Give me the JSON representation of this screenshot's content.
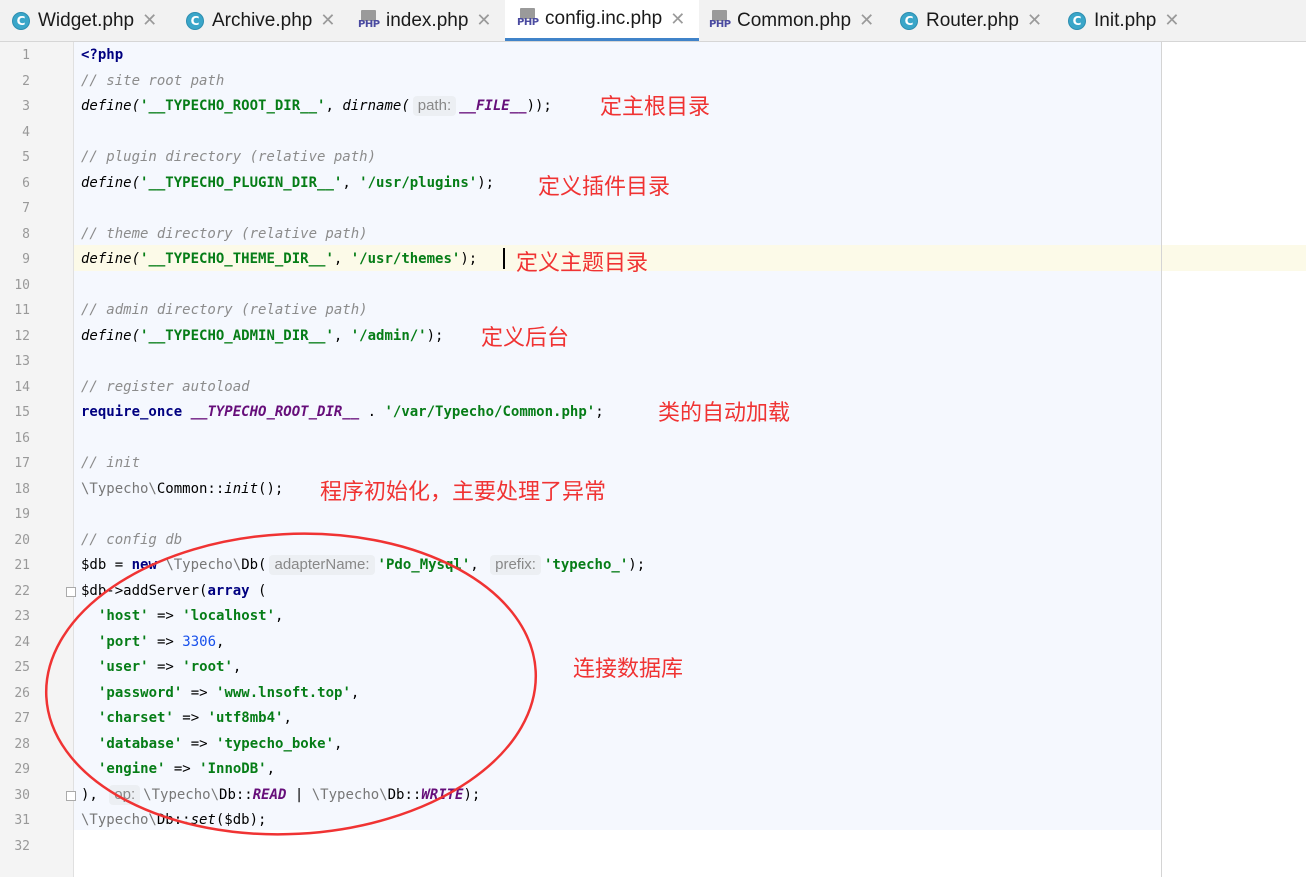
{
  "tabs": [
    {
      "name": "Widget.php",
      "icon": "class-c-icon",
      "active": false
    },
    {
      "name": "Archive.php",
      "icon": "class-c-icon",
      "active": false
    },
    {
      "name": "index.php",
      "icon": "php-file-icon",
      "active": false
    },
    {
      "name": "config.inc.php",
      "icon": "php-file-icon",
      "active": true
    },
    {
      "name": "Common.php",
      "icon": "php-file-icon",
      "active": false
    },
    {
      "name": "Router.php",
      "icon": "class-c-icon",
      "active": false
    },
    {
      "name": "Init.php",
      "icon": "class-c-icon",
      "active": false
    }
  ],
  "close_glyph": "✕",
  "line_numbers": [
    "1",
    "2",
    "3",
    "4",
    "5",
    "6",
    "7",
    "8",
    "9",
    "10",
    "11",
    "12",
    "13",
    "14",
    "15",
    "16",
    "17",
    "18",
    "19",
    "20",
    "21",
    "22",
    "23",
    "24",
    "25",
    "26",
    "27",
    "28",
    "29",
    "30",
    "31",
    "32"
  ],
  "code": {
    "l1": "<?php",
    "l2": "// site root path",
    "l3": {
      "a": "define(",
      "b": "'__TYPECHO_ROOT_DIR__'",
      "c": ", ",
      "d": "dirname(",
      "hint": "path:",
      "e": "__FILE__",
      "f": "));"
    },
    "l5": "// plugin directory (relative path)",
    "l6": {
      "a": "define(",
      "b": "'__TYPECHO_PLUGIN_DIR__'",
      "c": ", ",
      "d": "'/usr/plugins'",
      "e": ");"
    },
    "l8": "// theme directory (relative path)",
    "l9": {
      "a": "define(",
      "b": "'__TYPECHO_THEME_DIR__'",
      "c": ", ",
      "d": "'/usr/themes'",
      "e": ");"
    },
    "l11": "// admin directory (relative path)",
    "l12": {
      "a": "define(",
      "b": "'__TYPECHO_ADMIN_DIR__'",
      "c": ", ",
      "d": "'/admin/'",
      "e": ");"
    },
    "l14": "// register autoload",
    "l15": {
      "a": "require_once",
      "b": " ",
      "c": "__TYPECHO_ROOT_DIR__",
      "d": " . ",
      "e": "'/var/Typecho/Common.php'",
      "f": ";"
    },
    "l17": "// init",
    "l18": {
      "a": "\\Typecho\\",
      "b": "Common::",
      "c": "init",
      "d": "();"
    },
    "l20": "// config db",
    "l21": {
      "a": "$db",
      "b": " = ",
      "c": "new",
      "d": " \\Typecho\\",
      "e": "Db(",
      "hint1": "adapterName:",
      "f": "'Pdo_Mysql'",
      "g": ", ",
      "hint2": "prefix:",
      "h": "'typecho_'",
      "i": ");"
    },
    "l22": {
      "a": "$db",
      "b": "->addServer(",
      "c": "array",
      "d": " ("
    },
    "l23": {
      "k": "'host'",
      "op": " => ",
      "v": "'localhost'",
      "e": ","
    },
    "l24": {
      "k": "'port'",
      "op": " => ",
      "v": "3306",
      "e": ","
    },
    "l25": {
      "k": "'user'",
      "op": " => ",
      "v": "'root'",
      "e": ","
    },
    "l26": {
      "k": "'password'",
      "op": " => ",
      "v": "'www.lnsoft.top'",
      "e": ","
    },
    "l27": {
      "k": "'charset'",
      "op": " => ",
      "v": "'utf8mb4'",
      "e": ","
    },
    "l28": {
      "k": "'database'",
      "op": " => ",
      "v": "'typecho_boke'",
      "e": ","
    },
    "l29": {
      "k": "'engine'",
      "op": " => ",
      "v": "'InnoDB'",
      "e": ","
    },
    "l30": {
      "a": "),",
      "hint": "op:",
      "b": "\\Typecho\\",
      "c": "Db::",
      "d": "READ",
      "e": " | ",
      "f": "\\Typecho\\",
      "g": "Db::",
      "h": "WRITE",
      "i": ");"
    },
    "l31": {
      "a": "\\Typecho\\",
      "b": "Db::",
      "c": "set",
      "d": "($db);"
    }
  },
  "annotations": {
    "root": "定主根目录",
    "plugin": "定义插件目录",
    "theme": "定义主题目录",
    "admin": "定义后台",
    "autoload": "类的自动加载",
    "init": "程序初始化，主要处理了异常",
    "db": "连接数据库"
  },
  "colors": {
    "annotation": "#f03333",
    "active_tab_underline": "#4083c9",
    "current_line": "#fcfae8"
  }
}
